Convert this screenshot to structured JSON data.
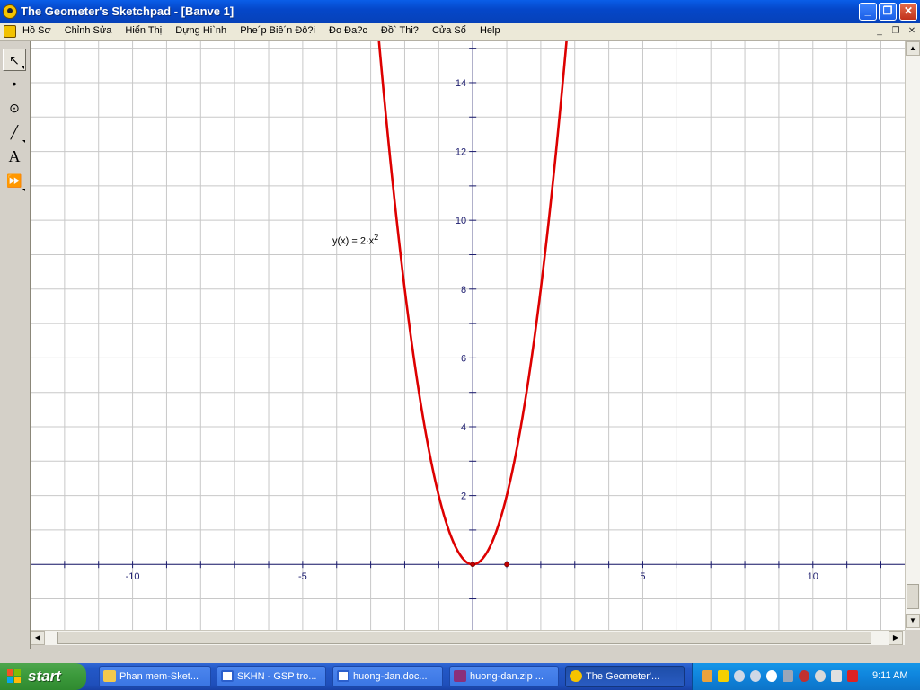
{
  "window": {
    "title": "The Geometer's Sketchpad - [Banve 1]",
    "min_glyph": "_",
    "restore_glyph": "❐",
    "close_glyph": "✕"
  },
  "menu": {
    "items": [
      "Hồ Sơ",
      "Chỉnh Sửa",
      "Hiển Thị",
      "Dựng Hi`nh",
      "Phe´p Biê´n Đô?i",
      "Đo Đa?c",
      "Đồ` Thi?",
      "Cửa Sổ",
      "Help"
    ],
    "mdi_min": "_",
    "mdi_restore": "❐",
    "mdi_close": "✕"
  },
  "toolbox": {
    "tools": [
      {
        "name": "arrow-tool",
        "glyph": "↖"
      },
      {
        "name": "point-tool",
        "glyph": "•"
      },
      {
        "name": "compass-tool",
        "glyph": "⊙"
      },
      {
        "name": "straightedge-tool",
        "glyph": "╱"
      },
      {
        "name": "text-tool",
        "glyph": "A"
      },
      {
        "name": "custom-tool",
        "glyph": "⏩"
      }
    ]
  },
  "chart_data": {
    "type": "line",
    "series": [
      {
        "name": "y(x) = 2·x²",
        "function": "2*x^2",
        "color": "#dd0000"
      }
    ],
    "xlim": [
      -13,
      12.7
    ],
    "ylim": [
      -1.9,
      15.2
    ],
    "x_ticks": [
      -10,
      -5,
      5,
      10
    ],
    "y_ticks": [
      2,
      4,
      6,
      8,
      10,
      12,
      14
    ],
    "grid": true,
    "points": [
      {
        "x": 0,
        "y": 0
      },
      {
        "x": 1,
        "y": 0
      }
    ],
    "annotation": {
      "prefix": "y(x) = 2·x",
      "sup": "2"
    }
  },
  "taskbar": {
    "start_label": "start",
    "tasks": [
      {
        "label": "Phan mem-Sket...",
        "icon": "folder-icon",
        "color": "#f2c94c"
      },
      {
        "label": "SKHN - GSP tro...",
        "icon": "word-icon",
        "color": "#2b5fcc"
      },
      {
        "label": "huong-dan.doc...",
        "icon": "word-icon",
        "color": "#2b5fcc"
      },
      {
        "label": "huong-dan.zip ...",
        "icon": "winrar-icon",
        "color": "#8a2f7a"
      },
      {
        "label": "The Geometer'...",
        "icon": "sketchpad-icon",
        "color": "#f6c400"
      }
    ],
    "clock": "9:11 AM"
  }
}
